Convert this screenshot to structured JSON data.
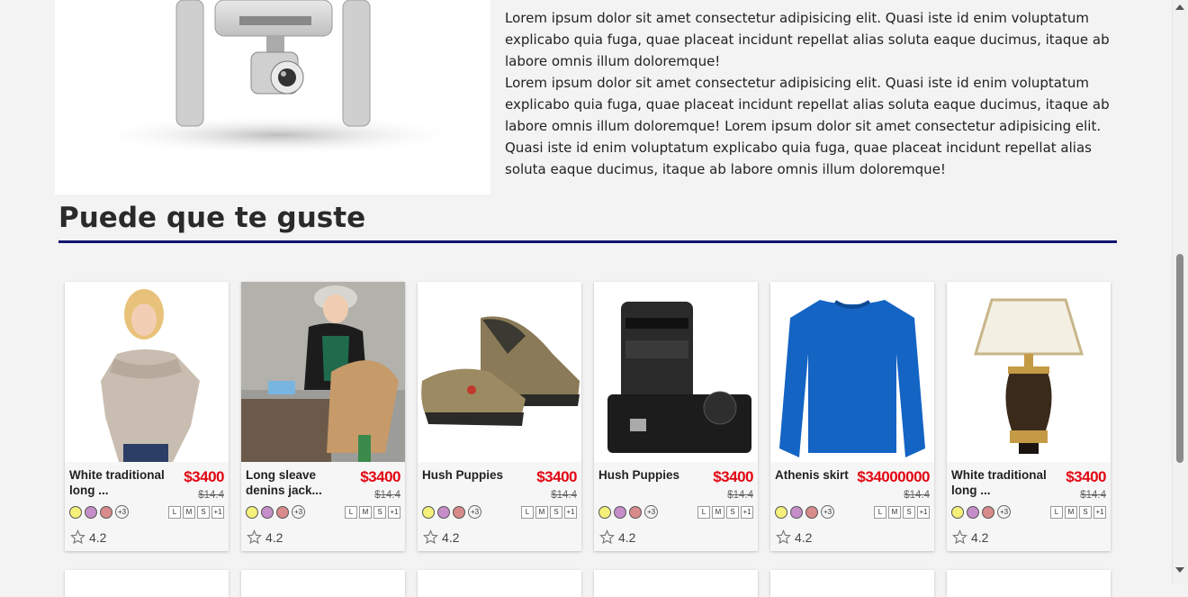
{
  "hero": {
    "paragraph1": "Lorem ipsum dolor sit amet consectetur adipisicing elit. Quasi iste id enim voluptatum explicabo quia fuga, quae placeat incidunt repellat alias soluta eaque ducimus, itaque ab labore omnis illum doloremque!",
    "paragraph2": "Lorem ipsum dolor sit amet consectetur adipisicing elit. Quasi iste id enim voluptatum explicabo quia fuga, quae placeat incidunt repellat alias soluta eaque ducimus, itaque ab labore omnis illum doloremque! Lorem ipsum dolor sit amet consectetur adipisicing elit. Quasi iste id enim voluptatum explicabo quia fuga, quae placeat incidunt repellat alias soluta eaque ducimus, itaque ab labore omnis illum doloremque!"
  },
  "section": {
    "title": "Puede que te guste",
    "rule_color": "#0f1470"
  },
  "swatches": [
    "#f5f07a",
    "#c58ec9",
    "#d98a8a"
  ],
  "swatch_more": "+3",
  "sizes": [
    "L",
    "M",
    "S",
    "+1"
  ],
  "products": [
    {
      "name": "White traditional long ...",
      "price": "$3400",
      "old_price": "$14.4",
      "rating": "4.2",
      "image": "woman-in-beige-sweater"
    },
    {
      "name": "Long sleave denins jack...",
      "price": "$3400",
      "old_price": "$14.4",
      "rating": "4.2",
      "image": "child-in-jacket"
    },
    {
      "name": "Hush Puppies",
      "price": "$3400",
      "old_price": "$14.4",
      "rating": "4.2",
      "image": "hiking-shoes"
    },
    {
      "name": "Hush Puppies",
      "price": "$3400",
      "old_price": "$14.4",
      "rating": "4.2",
      "image": "dslr-camera"
    },
    {
      "name": "Athenis skirt",
      "price": "$34000000",
      "old_price": "$14.4",
      "rating": "4.2",
      "image": "blue-sweater"
    },
    {
      "name": "White traditional long ...",
      "price": "$3400",
      "old_price": "$14.4",
      "rating": "4.2",
      "image": "table-lamp"
    }
  ],
  "colors": {
    "price": "#e30613",
    "accent": "#0f1470"
  }
}
